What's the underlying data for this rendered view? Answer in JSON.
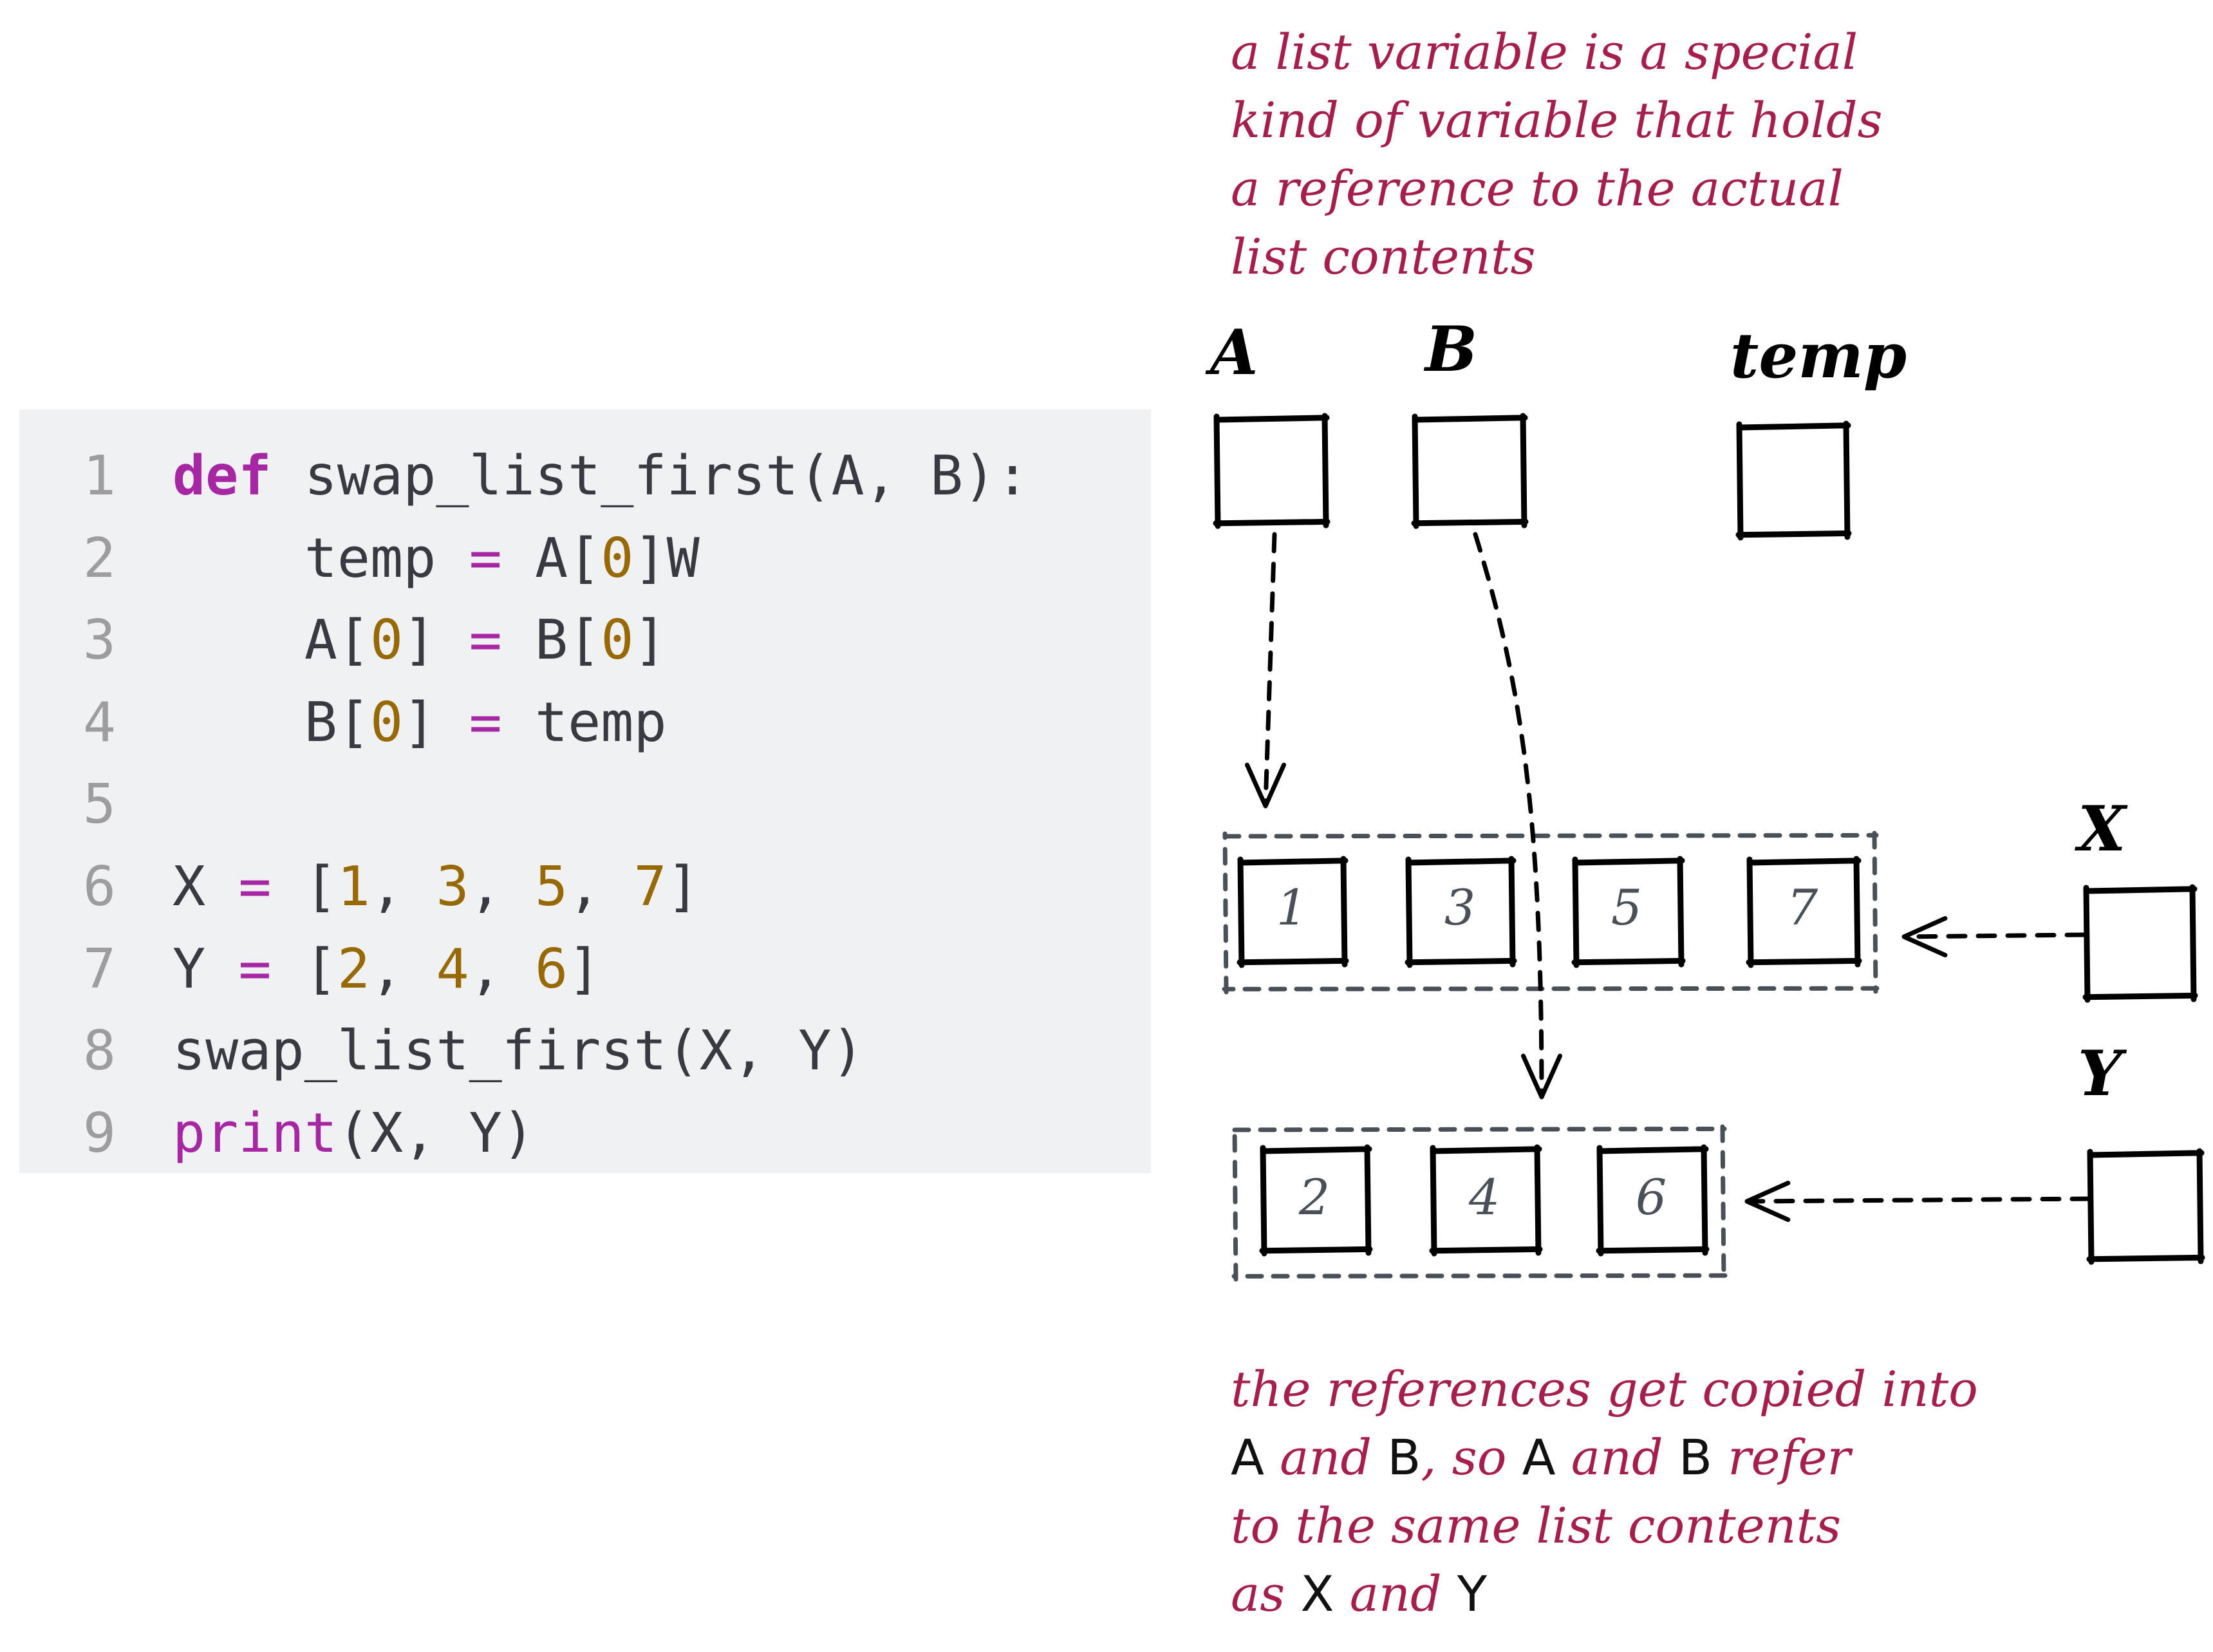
{
  "code": {
    "lines": [
      {
        "n": "1",
        "tokens": [
          {
            "t": "def",
            "k": "kw"
          },
          {
            "t": " swap_list_first(A, B):",
            "k": "plain"
          }
        ]
      },
      {
        "n": "2",
        "tokens": [
          {
            "t": "    temp ",
            "k": "plain"
          },
          {
            "t": "=",
            "k": "op"
          },
          {
            "t": " A[",
            "k": "plain"
          },
          {
            "t": "0",
            "k": "num"
          },
          {
            "t": "]W",
            "k": "plain"
          }
        ]
      },
      {
        "n": "3",
        "tokens": [
          {
            "t": "    A[",
            "k": "plain"
          },
          {
            "t": "0",
            "k": "num"
          },
          {
            "t": "] ",
            "k": "plain"
          },
          {
            "t": "=",
            "k": "op"
          },
          {
            "t": " B[",
            "k": "plain"
          },
          {
            "t": "0",
            "k": "num"
          },
          {
            "t": "]",
            "k": "plain"
          }
        ]
      },
      {
        "n": "4",
        "tokens": [
          {
            "t": "    B[",
            "k": "plain"
          },
          {
            "t": "0",
            "k": "num"
          },
          {
            "t": "] ",
            "k": "plain"
          },
          {
            "t": "=",
            "k": "op"
          },
          {
            "t": " temp",
            "k": "plain"
          }
        ]
      },
      {
        "n": "5",
        "tokens": []
      },
      {
        "n": "6",
        "tokens": [
          {
            "t": "X ",
            "k": "plain"
          },
          {
            "t": "=",
            "k": "op"
          },
          {
            "t": " [",
            "k": "plain"
          },
          {
            "t": "1",
            "k": "num"
          },
          {
            "t": ", ",
            "k": "plain"
          },
          {
            "t": "3",
            "k": "num"
          },
          {
            "t": ", ",
            "k": "plain"
          },
          {
            "t": "5",
            "k": "num"
          },
          {
            "t": ", ",
            "k": "plain"
          },
          {
            "t": "7",
            "k": "num"
          },
          {
            "t": "]",
            "k": "plain"
          }
        ]
      },
      {
        "n": "7",
        "tokens": [
          {
            "t": "Y ",
            "k": "plain"
          },
          {
            "t": "=",
            "k": "op"
          },
          {
            "t": " [",
            "k": "plain"
          },
          {
            "t": "2",
            "k": "num"
          },
          {
            "t": ", ",
            "k": "plain"
          },
          {
            "t": "4",
            "k": "num"
          },
          {
            "t": ", ",
            "k": "plain"
          },
          {
            "t": "6",
            "k": "num"
          },
          {
            "t": "]",
            "k": "plain"
          }
        ]
      },
      {
        "n": "8",
        "tokens": [
          {
            "t": "swap_list_first(X, Y)",
            "k": "plain"
          }
        ]
      },
      {
        "n": "9",
        "tokens": [
          {
            "t": "print",
            "k": "bi"
          },
          {
            "t": "(X, Y)",
            "k": "plain"
          }
        ]
      }
    ]
  },
  "diagram": {
    "top_note": [
      "a list variable is a special",
      "kind of variable that holds",
      "a reference to the actual",
      "list contents"
    ],
    "bottom_note": [
      [
        {
          "t": "the references get copied into",
          "plain": false
        }
      ],
      [
        {
          "t": "A",
          "plain": true
        },
        {
          "t": " and ",
          "plain": false
        },
        {
          "t": "B",
          "plain": true
        },
        {
          "t": ", so ",
          "plain": false
        },
        {
          "t": "A",
          "plain": true
        },
        {
          "t": " and ",
          "plain": false
        },
        {
          "t": "B",
          "plain": true
        },
        {
          "t": " refer",
          "plain": false
        }
      ],
      [
        {
          "t": "to the same list contents",
          "plain": false
        }
      ],
      [
        {
          "t": "as ",
          "plain": false
        },
        {
          "t": "X",
          "plain": true
        },
        {
          "t": " and ",
          "plain": false
        },
        {
          "t": "Y",
          "plain": true
        }
      ]
    ],
    "variables": {
      "A": "A",
      "B": "B",
      "temp": "temp",
      "X": "X",
      "Y": "Y"
    },
    "list_x": [
      "1",
      "3",
      "5",
      "7"
    ],
    "list_y": [
      "2",
      "4",
      "6"
    ],
    "references": [
      {
        "from": "A",
        "to": "list_x"
      },
      {
        "from": "B",
        "to": "list_y"
      },
      {
        "from": "X",
        "to": "list_x"
      },
      {
        "from": "Y",
        "to": "list_y"
      }
    ],
    "colors": {
      "annotation": "#a61e4d",
      "ink": "#000000",
      "list_outline": "#495057",
      "code_keyword": "#a626a4",
      "code_number": "#986801",
      "code_text": "#383a42",
      "code_line_number": "#9d9d9f",
      "code_background": "#f0f1f3"
    }
  }
}
